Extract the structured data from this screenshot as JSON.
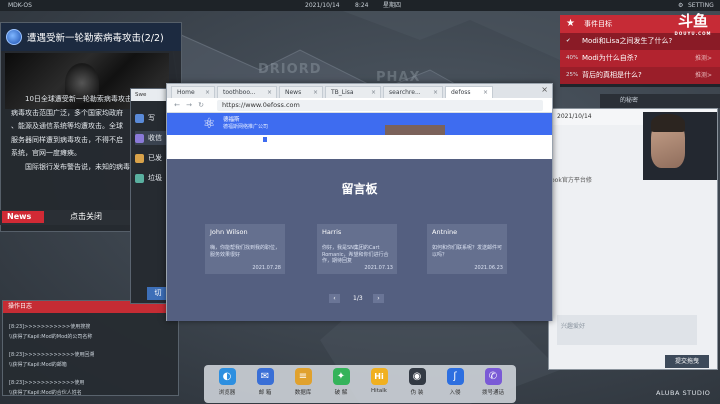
{
  "statusbar": {
    "os_name": "MDK-OS",
    "date": "2021/10/14",
    "time": "8:24",
    "weekday": "星期四",
    "settings_label": "SETTING"
  },
  "map": {
    "labels": [
      "DRIORD",
      "PHAX"
    ]
  },
  "news": {
    "title": "遭遇受新一轮勒索病毒攻击(2/2)",
    "body": [
      "10日全球遭受新一轮勒索病毒攻击",
      "病毒攻击范围广泛，多个国家均政府",
      "、能源及通信系统等均遭攻击。全球",
      "服务器同样遭到病毒攻击，不得不启",
      "系统，官网一度瘫痪。",
      "国际银行发布警告说，未知的病毒"
    ],
    "tag": "News",
    "close_label": "点击关闭"
  },
  "log": {
    "title": "操作日志",
    "lines": [
      "[8:23]>>>>>>>>>>>使用搜搜",
      "\\\\获得了Kapil:Mod的Mod的公司名称",
      "[8:23]>>>>>>>>>>>>使用回溯",
      "\\\\获得了Kapil:Mod的邮箱",
      "[8:23]>>>>>>>>>>>>使用",
      "\\\\获得了Kapil:Mod的合伙人姓名"
    ]
  },
  "mail": {
    "header": "Swe",
    "items": [
      "写",
      "收信",
      "已发",
      "垃圾"
    ],
    "button_label": "切"
  },
  "events": {
    "title": "事件目标",
    "rows": [
      {
        "pct": "",
        "text": "Modi和Lisa之间发生了什么?",
        "action": ""
      },
      {
        "pct": "40%",
        "text": "Modi为什么自杀?",
        "action": "推测>"
      },
      {
        "pct": "25%",
        "text": "背后的真相是什么?",
        "action": "推测>"
      }
    ]
  },
  "logo": {
    "main": "斗鱼",
    "sub": "DOUYU.COM"
  },
  "right_windows": {
    "secret_text": "的秘密",
    "chat_date": "2021/10/14",
    "chat_snippet": "ook官方平台修",
    "input_hint": "兴趣爱好",
    "send_label": "提交拖曳"
  },
  "browser": {
    "tabs": [
      "Home",
      "toothboo...",
      "News",
      "TB_Lisa",
      "searchre...",
      "defoss"
    ],
    "url": "https://www.0efoss.com",
    "site_name": "德福斯",
    "site_sub": "德福斯网络推广公司",
    "board_title": "留言板",
    "cards": [
      {
        "name": "John Wilson",
        "msg": "嗨，你能帮我们找到我的职位，服务效果很好",
        "date": "2021.07.28"
      },
      {
        "name": "Harris",
        "msg": "你好，我是SN集团的Cart Romanic，希望和你们进行合作，期待回复",
        "date": "2021.07.13"
      },
      {
        "name": "Antnine",
        "msg": "如何和你们联系呢？发送邮件可以吗？",
        "date": "2021.06.23"
      }
    ],
    "pager": {
      "prev": "‹",
      "text": "1/3",
      "next": "›"
    }
  },
  "dock": {
    "items": [
      {
        "label": "浏览器",
        "icon": "browser-icon",
        "color": "#2d8fe0",
        "glyph": "◐"
      },
      {
        "label": "邮 箱",
        "icon": "mail-icon",
        "color": "#3a6fd6",
        "glyph": "✉"
      },
      {
        "label": "数据库",
        "icon": "database-icon",
        "color": "#e0a12d",
        "glyph": "≡"
      },
      {
        "label": "破 解",
        "icon": "crack-icon",
        "color": "#34b35a",
        "glyph": "✦"
      },
      {
        "label": "Hitalk",
        "icon": "hitalk-icon",
        "color": "#f0b020",
        "glyph": "Hi"
      },
      {
        "label": "伪 装",
        "icon": "disguise-icon",
        "color": "#333a44",
        "glyph": "◉"
      },
      {
        "label": "入侵",
        "icon": "intrude-icon",
        "color": "#2d6fe0",
        "glyph": "ʃ"
      },
      {
        "label": "拨号通话",
        "icon": "phone-icon",
        "color": "#7a5ad6",
        "glyph": "✆"
      }
    ]
  },
  "studio": "ALUBA STUDIO"
}
